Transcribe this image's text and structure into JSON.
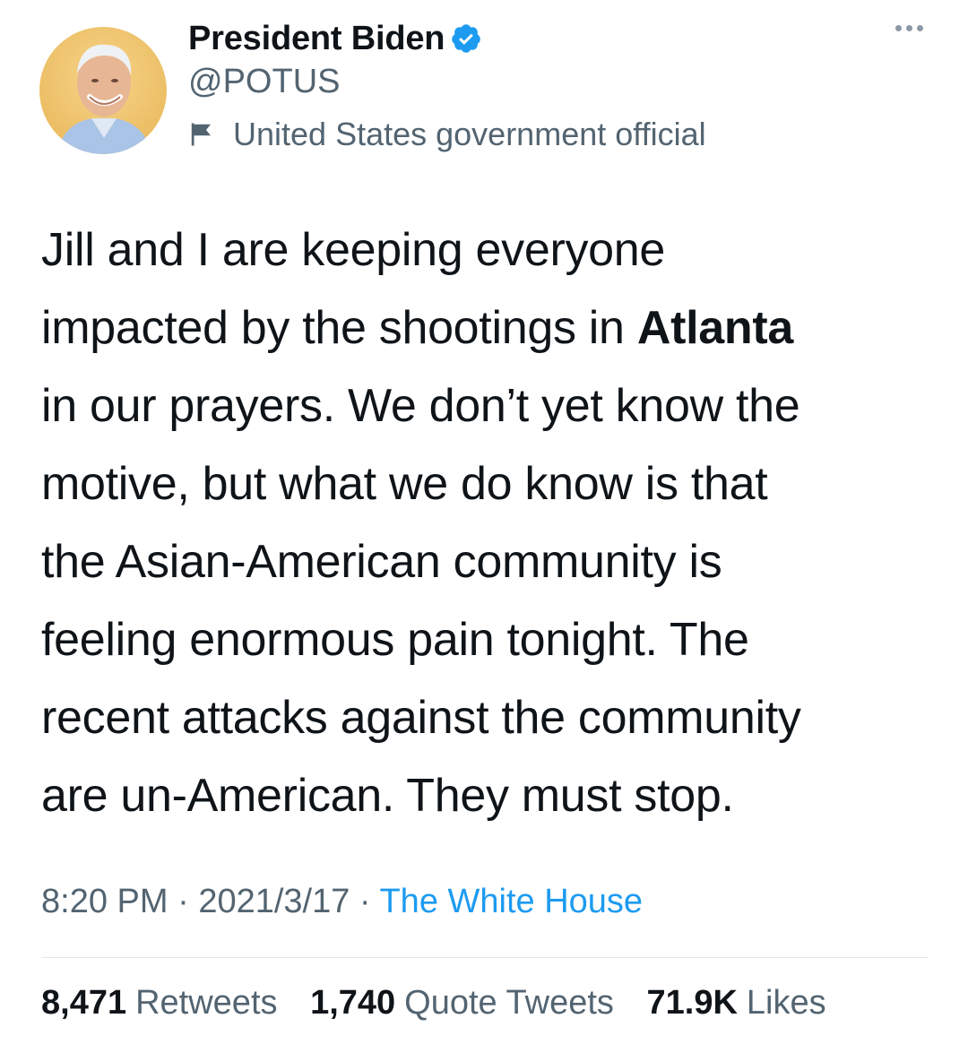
{
  "author": {
    "display_name": "President Biden",
    "handle": "@POTUS",
    "label": "United States government official",
    "verified": true,
    "verified_icon": "verified-badge-icon",
    "label_icon": "flag-icon"
  },
  "more_icon": "more-options-icon",
  "tweet": {
    "lines": [
      {
        "text": "Jill and I are keeping everyone"
      },
      {
        "pre": "impacted by the shootings in ",
        "bold": "Atlanta"
      },
      {
        "text": "in our prayers. We don’t yet know the"
      },
      {
        "text": "motive, but what we do know is that"
      },
      {
        "text": "the Asian-American community is"
      },
      {
        "text": "feeling enormous pain tonight. The"
      },
      {
        "text": "recent attacks against the community"
      },
      {
        "text": "are un-American. They must stop."
      }
    ]
  },
  "meta": {
    "time": "8:20 PM",
    "separator": " · ",
    "date": "2021/3/17",
    "source": "The White House"
  },
  "stats": {
    "retweets_count": "8,471",
    "retweets_label": "Retweets",
    "quotes_count": "1,740",
    "quotes_label": "Quote Tweets",
    "likes_count": "71.9K",
    "likes_label": "Likes"
  },
  "colors": {
    "link": "#1d9bf0",
    "secondary_text": "#536471",
    "primary_text": "#0f1419"
  }
}
